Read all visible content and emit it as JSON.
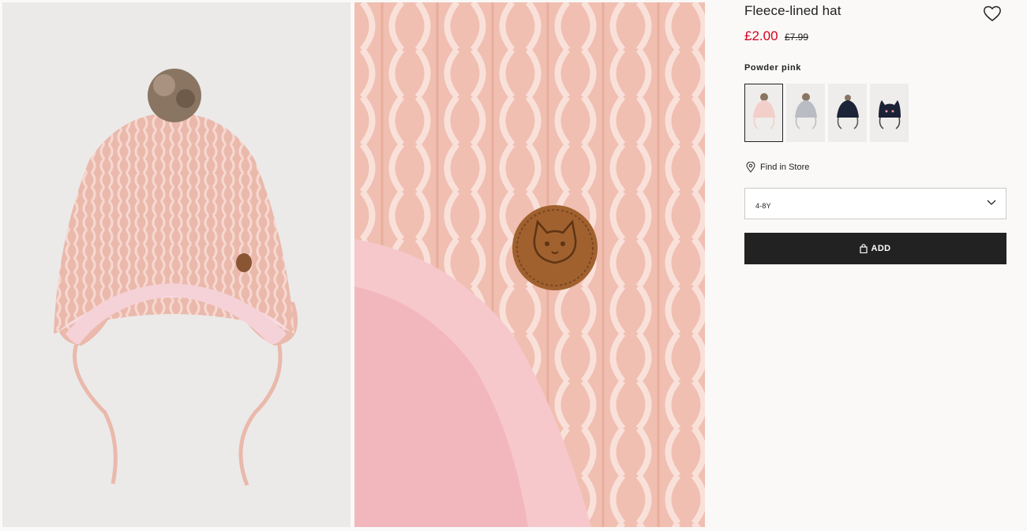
{
  "product": {
    "title": "Fleece-lined hat",
    "price_now": "£2.00",
    "price_was": "£7.99",
    "color_name": "Powder pink",
    "swatches": [
      {
        "name": "powder-pink",
        "color": "#f2cfc8",
        "selected": true
      },
      {
        "name": "grey",
        "color": "#b9bcc2",
        "selected": false
      },
      {
        "name": "navy",
        "color": "#1d2438",
        "selected": false
      },
      {
        "name": "navy-cat",
        "color": "#1a2036",
        "selected": false
      }
    ]
  },
  "actions": {
    "find_in_store": "Find in Store",
    "size_value": "4-8Y",
    "add_label": "ADD"
  },
  "colors": {
    "sale_red": "#d6001c",
    "button_dark": "#222222",
    "page_bg": "#faf9f8"
  },
  "icons": {
    "wishlist": "heart-outline-icon",
    "store": "map-pin-icon",
    "dropdown": "chevron-down-icon",
    "bag": "shopping-bag-icon"
  }
}
